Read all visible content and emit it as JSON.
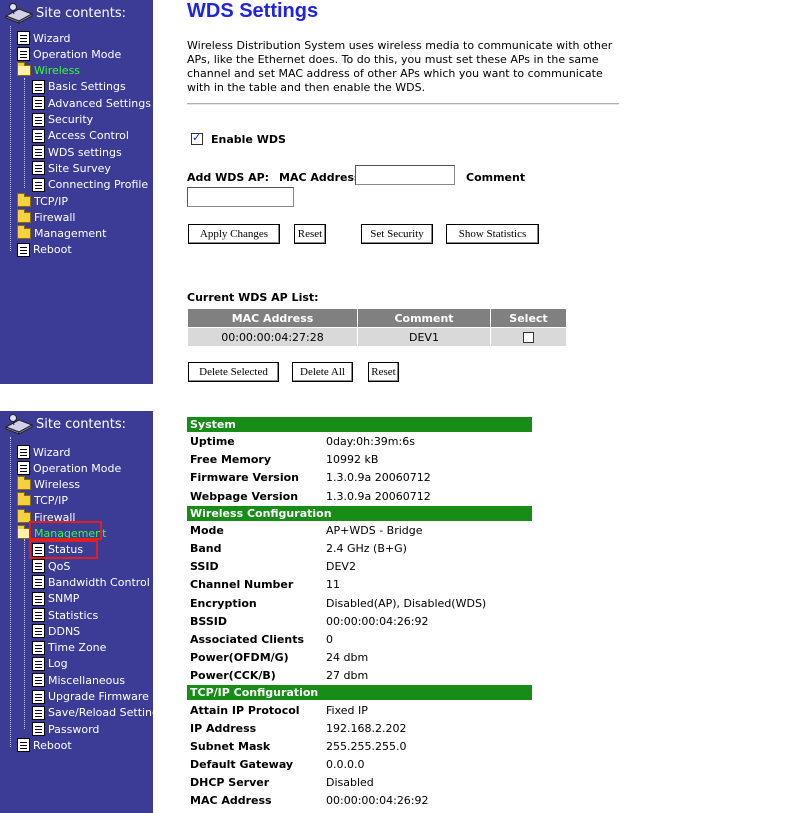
{
  "panel1": {
    "sidebar": {
      "title": "Site contents:",
      "items": [
        {
          "label": "Wizard",
          "icon": "doc-icon"
        },
        {
          "label": "Operation Mode",
          "icon": "doc-icon"
        },
        {
          "label": "Wireless",
          "icon": "open-folder-icon",
          "active": true
        },
        {
          "label": "Basic Settings",
          "icon": "doc-icon"
        },
        {
          "label": "Advanced Settings",
          "icon": "doc-icon"
        },
        {
          "label": "Security",
          "icon": "doc-icon"
        },
        {
          "label": "Access Control",
          "icon": "doc-icon"
        },
        {
          "label": "WDS settings",
          "icon": "doc-icon"
        },
        {
          "label": "Site Survey",
          "icon": "doc-icon"
        },
        {
          "label": "Connecting Profile",
          "icon": "doc-icon"
        },
        {
          "label": "TCP/IP",
          "icon": "folder-icon"
        },
        {
          "label": "Firewall",
          "icon": "folder-icon"
        },
        {
          "label": "Management",
          "icon": "folder-icon"
        },
        {
          "label": "Reboot",
          "icon": "doc-icon"
        }
      ]
    },
    "title": "WDS Settings",
    "description": "Wireless Distribution System uses wireless media to communicate with other APs, like the Ethernet does. To do this, you must set these APs in the same channel and set MAC address of other APs which you want to communicate with in the table and then enable the WDS.",
    "enable_wds_label": "Enable WDS",
    "enable_wds_checked": true,
    "add_wds_ap_label": "Add WDS AP:",
    "mac_address_label": "MAC Address",
    "comment_label": "Comment",
    "mac_input_value": "",
    "comment_input_value": "",
    "buttons": {
      "apply": "Apply Changes",
      "reset": "Reset",
      "set_security": "Set Security",
      "show_statistics": "Show Statistics",
      "delete_selected": "Delete Selected",
      "delete_all": "Delete All",
      "reset2": "Reset"
    },
    "list_title": "Current WDS AP List:",
    "table": {
      "headers": [
        "MAC Address",
        "Comment",
        "Select"
      ],
      "rows": [
        {
          "mac": "00:00:00:04:27:28",
          "comment": "DEV1",
          "selected": false
        }
      ]
    }
  },
  "panel2": {
    "sidebar": {
      "title": "Site contents:",
      "items": [
        {
          "label": "Wizard",
          "icon": "doc-icon"
        },
        {
          "label": "Operation Mode",
          "icon": "doc-icon"
        },
        {
          "label": "Wireless",
          "icon": "folder-icon"
        },
        {
          "label": "TCP/IP",
          "icon": "folder-icon"
        },
        {
          "label": "Firewall",
          "icon": "folder-icon"
        },
        {
          "label": "Management",
          "icon": "open-folder-icon",
          "active": true
        },
        {
          "label": "Status",
          "icon": "doc-icon"
        },
        {
          "label": "QoS",
          "icon": "doc-icon"
        },
        {
          "label": "Bandwidth Control",
          "icon": "doc-icon"
        },
        {
          "label": "SNMP",
          "icon": "doc-icon"
        },
        {
          "label": "Statistics",
          "icon": "doc-icon"
        },
        {
          "label": "DDNS",
          "icon": "doc-icon"
        },
        {
          "label": "Time Zone",
          "icon": "doc-icon"
        },
        {
          "label": "Log",
          "icon": "doc-icon"
        },
        {
          "label": "Miscellaneous",
          "icon": "doc-icon"
        },
        {
          "label": "Upgrade Firmware",
          "icon": "doc-icon"
        },
        {
          "label": "Save/Reload Setting",
          "icon": "doc-icon"
        },
        {
          "label": "Password",
          "icon": "doc-icon"
        },
        {
          "label": "Reboot",
          "icon": "doc-icon"
        }
      ]
    },
    "status_sections": [
      {
        "title": "System",
        "rows": [
          [
            "Uptime",
            "0day:0h:39m:6s"
          ],
          [
            "Free Memory",
            "10992 kB"
          ],
          [
            "Firmware Version",
            "1.3.0.9a 20060712"
          ],
          [
            "Webpage Version",
            "1.3.0.9a 20060712"
          ]
        ]
      },
      {
        "title": "Wireless Configuration",
        "rows": [
          [
            "Mode",
            "AP+WDS - Bridge"
          ],
          [
            "Band",
            "2.4 GHz (B+G)"
          ],
          [
            "SSID",
            "DEV2"
          ],
          [
            "Channel Number",
            "11"
          ],
          [
            "Encryption",
            "Disabled(AP), Disabled(WDS)"
          ],
          [
            "BSSID",
            "00:00:00:04:26:92"
          ],
          [
            "Associated Clients",
            "0"
          ],
          [
            "Power(OFDM/G)",
            "24 dbm"
          ],
          [
            "Power(CCK/B)",
            "27 dbm"
          ]
        ]
      },
      {
        "title": "TCP/IP Configuration",
        "rows": [
          [
            "Attain IP Protocol",
            "Fixed IP"
          ],
          [
            "IP Address",
            "192.168.2.202"
          ],
          [
            "Subnet Mask",
            "255.255.255.0"
          ],
          [
            "Default Gateway",
            "0.0.0.0"
          ],
          [
            "DHCP Server",
            "Disabled"
          ],
          [
            "MAC Address",
            "00:00:00:04:26:92"
          ]
        ]
      }
    ]
  },
  "colors": {
    "sidebar_bg": "#3c3c96",
    "title_blue": "#1f23e6",
    "active_green": "#33ff33",
    "section_green": "#178c17",
    "table_header_gray": "#808080",
    "highlight_red": "#e02020"
  }
}
